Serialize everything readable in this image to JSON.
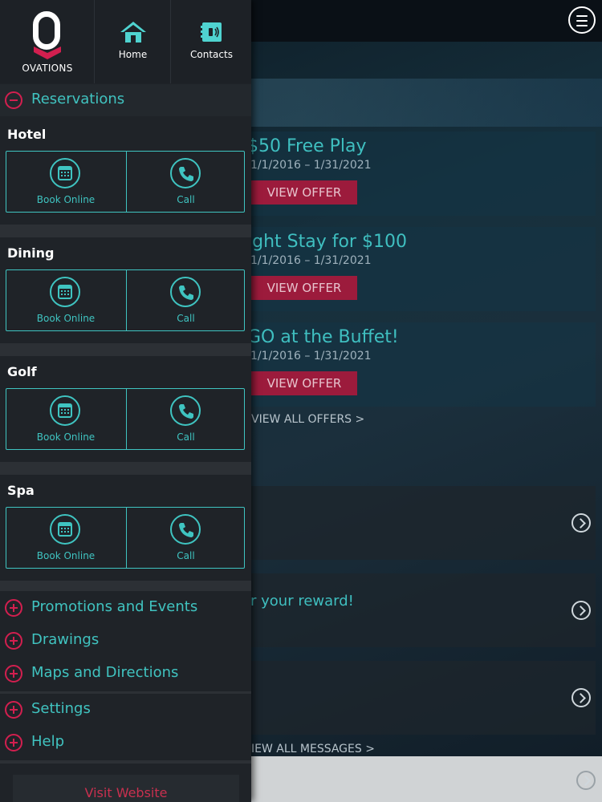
{
  "header": {
    "brand": "OVATIONS",
    "nav": [
      {
        "label": "Home",
        "icon": "home-icon"
      },
      {
        "label": "Contacts",
        "icon": "contacts-icon"
      }
    ]
  },
  "drawer": {
    "reservations_label": "Reservations",
    "categories": [
      {
        "name": "Hotel",
        "book_label": "Book Online",
        "call_label": "Call"
      },
      {
        "name": "Dining",
        "book_label": "Book Online",
        "call_label": "Call"
      },
      {
        "name": "Golf",
        "book_label": "Book Online",
        "call_label": "Call"
      },
      {
        "name": "Spa",
        "book_label": "Book Online",
        "call_label": "Call"
      }
    ],
    "menu_items": [
      "Promotions and Events",
      "Drawings",
      "Maps and Directions",
      "Settings",
      "Help"
    ],
    "visit_label": "Visit Website"
  },
  "background": {
    "offers": [
      {
        "title": "$50 Free Play",
        "dates": "1/1/2016 – 1/31/2021",
        "button": "VIEW OFFER"
      },
      {
        "title": "ight Stay for $100",
        "dates": "1/1/2016 – 1/31/2021",
        "button": "VIEW OFFER"
      },
      {
        "title": "GO at the Buffet!",
        "dates": "1/1/2016 – 1/31/2021",
        "button": "VIEW OFFER"
      }
    ],
    "view_all_offers": "VIEW ALL OFFERS >",
    "reward_text": "r your reward!",
    "view_all_messages": "IEW ALL MESSAGES >"
  },
  "colors": {
    "accent_teal": "#3fc4c1",
    "accent_red": "#d21f4f",
    "drawer_bg": "#1f2328"
  }
}
